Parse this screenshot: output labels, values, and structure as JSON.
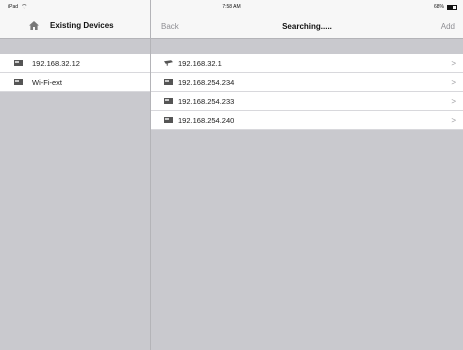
{
  "status": {
    "device": "iPad",
    "time": "7:58 AM",
    "battery": "68%",
    "battery_level": 0.68
  },
  "left": {
    "title": "Existing Devices",
    "devices": [
      {
        "label": "192.168.32.12",
        "icon": "router-icon"
      },
      {
        "label": "Wi-Fi-ext",
        "icon": "router-icon"
      }
    ]
  },
  "right": {
    "back": "Back",
    "title": "Searching.....",
    "add": "Add",
    "results": [
      {
        "label": "192.168.32.1",
        "icon": "camera-icon"
      },
      {
        "label": "192.168.254.234",
        "icon": "router-icon"
      },
      {
        "label": "192.168.254.233",
        "icon": "router-icon"
      },
      {
        "label": "192.168.254.240",
        "icon": "router-icon"
      }
    ]
  }
}
